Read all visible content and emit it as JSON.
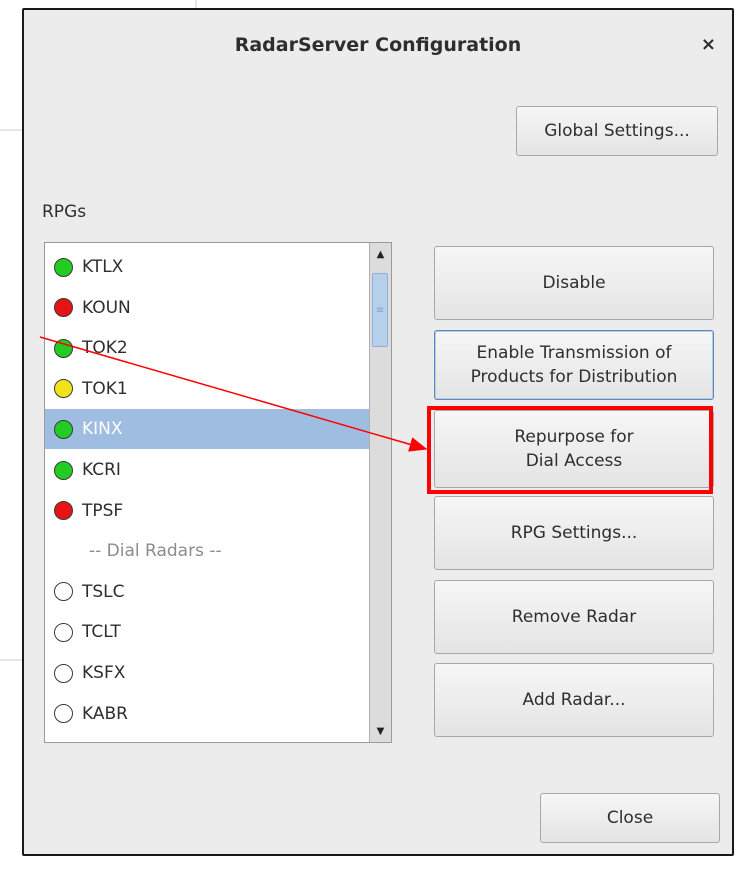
{
  "dialog": {
    "title": "RadarServer Configuration",
    "close_icon": "×"
  },
  "global_settings_label": "Global Settings...",
  "rpgs_label": "RPGs",
  "rpg_list": [
    {
      "name": "KTLX",
      "status_color": "#22cc22"
    },
    {
      "name": "KOUN",
      "status_color": "#e61414"
    },
    {
      "name": "TOK2",
      "status_color": "#22cc22"
    },
    {
      "name": "TOK1",
      "status_color": "#f2e21a"
    },
    {
      "name": "KINX",
      "status_color": "#22cc22",
      "selected": true
    },
    {
      "name": "KCRI",
      "status_color": "#22cc22"
    },
    {
      "name": "TPSF",
      "status_color": "#e61414"
    }
  ],
  "dial_section_label": "-- Dial Radars --",
  "dial_list": [
    {
      "name": "TSLC"
    },
    {
      "name": "TCLT"
    },
    {
      "name": "KSFX"
    },
    {
      "name": "KABR"
    }
  ],
  "actions": {
    "disable": "Disable",
    "enable_transmission_line1": "Enable Transmission of",
    "enable_transmission_line2": "Products for Distribution",
    "repurpose_line1": "Repurpose for",
    "repurpose_line2": "Dial Access",
    "rpg_settings": "RPG Settings...",
    "remove_radar": "Remove Radar",
    "add_radar": "Add Radar..."
  },
  "close_label": "Close",
  "annotation_color": "#ff0000",
  "icons": [
    "close-icon",
    "scroll-up-icon",
    "scroll-down-icon",
    "scroll-grip-icon"
  ]
}
